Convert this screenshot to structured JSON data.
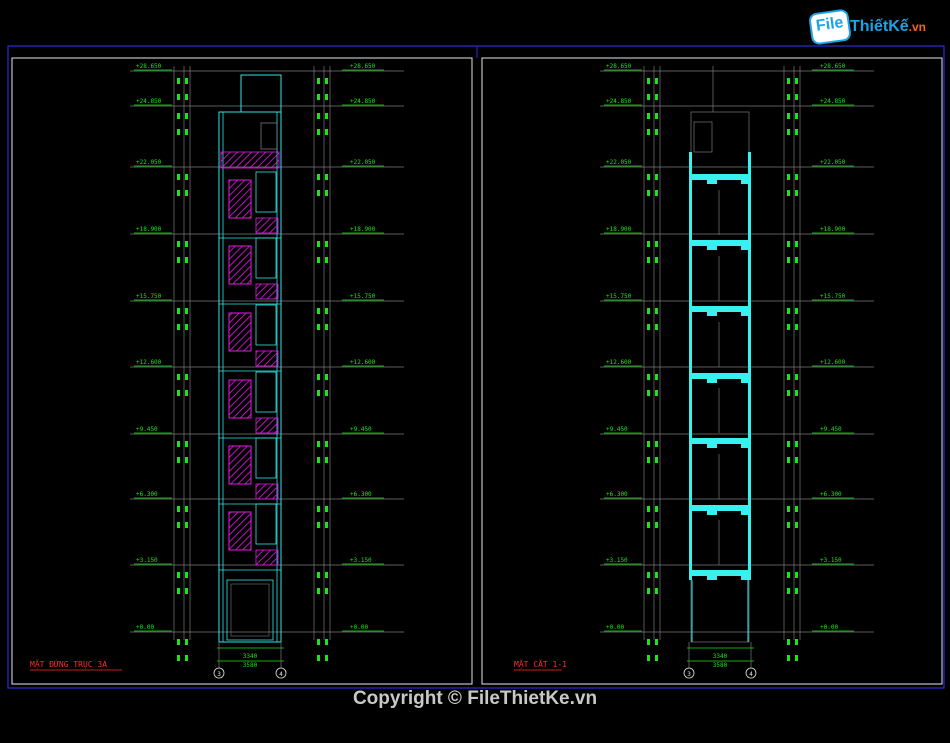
{
  "logo": {
    "file": "File",
    "brand": "ThiếtKế",
    "tld": ".vn"
  },
  "copyright": "Copyright © FileThietKe.vn",
  "left_drawing": {
    "title": "MẶT ĐỨNG TRỤC 3A",
    "levels_left": [
      "+28.650",
      "+24.850",
      "+22.050",
      "+18.900",
      "+15.750",
      "+12.600",
      "+9.450",
      "+6.300",
      "+3.150",
      "+0.00"
    ],
    "levels_right": [
      "+28.650",
      "+24.850",
      "+22.050",
      "+18.900",
      "+15.750",
      "+12.600",
      "+9.450",
      "+6.300",
      "+3.150",
      "+0.00"
    ],
    "axes": [
      "3",
      "4"
    ],
    "dims": [
      "3340",
      "3580"
    ]
  },
  "right_drawing": {
    "title": "MẶT CẮT 1-1",
    "levels_left": [
      "+28.650",
      "+24.850",
      "+22.050",
      "+18.900",
      "+15.750",
      "+12.600",
      "+9.450",
      "+6.300",
      "+3.150",
      "+0.00"
    ],
    "levels_right": [
      "+28.650",
      "+24.850",
      "+22.050",
      "+18.900",
      "+15.750",
      "+12.600",
      "+9.450",
      "+6.300",
      "+3.150",
      "+0.00"
    ],
    "axes": [
      "3",
      "4"
    ],
    "dims": [
      "3340",
      "3580"
    ]
  },
  "colors": {
    "frame": "#2b2bd8",
    "sheet": "#e6e6e6",
    "green": "#19e619",
    "cyan": "#2ee6e6",
    "magenta": "#e619e6",
    "red": "#ff2a2a",
    "grid": "#7a7a7a",
    "slab": "#39f0f0"
  }
}
